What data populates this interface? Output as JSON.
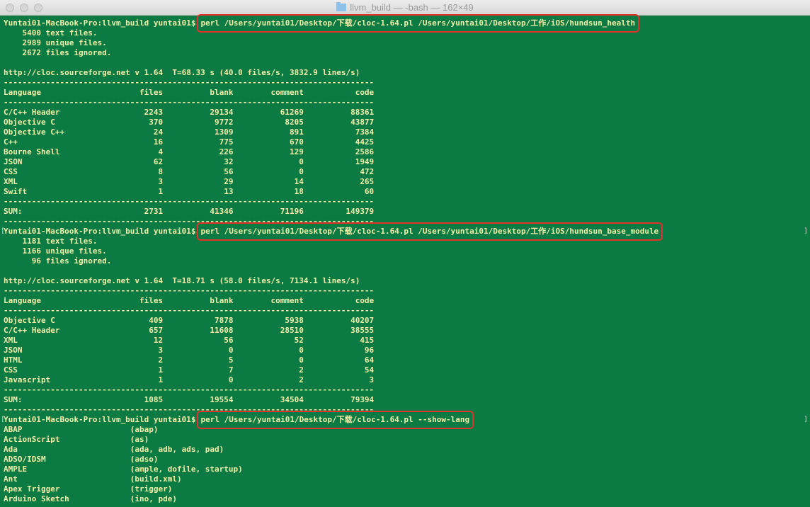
{
  "window": {
    "title": "llvm_build — -bash — 162×49"
  },
  "terminal": {
    "lines": [
      {
        "prompt": "Yuntai01-MacBook-Pro:llvm_build yuntai01$",
        "cmd": "perl /Users/yuntai01/Desktop/下载/cloc-1.64.pl /Users/yuntai01/Desktop/工作/iOS/hundsun_health"
      },
      {
        "text": "    5400 text files."
      },
      {
        "text": "    2989 unique files."
      },
      {
        "text": "    2672 files ignored."
      },
      {
        "text": ""
      },
      {
        "text": "http://cloc.sourceforge.net v 1.64  T=68.33 s (40.0 files/s, 3832.9 lines/s)"
      },
      {
        "text": "-------------------------------------------------------------------------------"
      },
      {
        "text": "Language                     files          blank        comment           code"
      },
      {
        "text": "-------------------------------------------------------------------------------"
      },
      {
        "text": "C/C++ Header                  2243          29134          61269          88361"
      },
      {
        "text": "Objective C                    370           9772           8205          43877"
      },
      {
        "text": "Objective C++                   24           1309            891           7384"
      },
      {
        "text": "C++                             16            775            670           4425"
      },
      {
        "text": "Bourne Shell                     4            226            129           2586"
      },
      {
        "text": "JSON                            62             32              0           1949"
      },
      {
        "text": "CSS                              8             56              0            472"
      },
      {
        "text": "XML                              3             29             14            265"
      },
      {
        "text": "Swift                            1             13             18             60"
      },
      {
        "text": "-------------------------------------------------------------------------------"
      },
      {
        "text": "SUM:                          2731          41346          71196         149379"
      },
      {
        "text": "-------------------------------------------------------------------------------"
      },
      {
        "prompt": "Yuntai01-MacBook-Pro:llvm_build yuntai01$",
        "cmd": "perl /Users/yuntai01/Desktop/下载/cloc-1.64.pl /Users/yuntai01/Desktop/工作/iOS/hundsun_base_module",
        "marks": true
      },
      {
        "text": "    1181 text files."
      },
      {
        "text": "    1166 unique files."
      },
      {
        "text": "      96 files ignored."
      },
      {
        "text": ""
      },
      {
        "text": "http://cloc.sourceforge.net v 1.64  T=18.71 s (58.0 files/s, 7134.1 lines/s)"
      },
      {
        "text": "-------------------------------------------------------------------------------"
      },
      {
        "text": "Language                     files          blank        comment           code"
      },
      {
        "text": "-------------------------------------------------------------------------------"
      },
      {
        "text": "Objective C                    409           7878           5938          40207"
      },
      {
        "text": "C/C++ Header                   657          11608          28510          38555"
      },
      {
        "text": "XML                             12             56             52            415"
      },
      {
        "text": "JSON                             3              0              0             96"
      },
      {
        "text": "HTML                             2              5              0             64"
      },
      {
        "text": "CSS                              1              7              2             54"
      },
      {
        "text": "Javascript                       1              0              2              3"
      },
      {
        "text": "-------------------------------------------------------------------------------"
      },
      {
        "text": "SUM:                          1085          19554          34504          79394"
      },
      {
        "text": "-------------------------------------------------------------------------------"
      },
      {
        "prompt": "Yuntai01-MacBook-Pro:llvm_build yuntai01$",
        "cmd": "perl /Users/yuntai01/Desktop/下载/cloc-1.64.pl --show-lang",
        "marks": true
      },
      {
        "text": "ABAP                       (abap)"
      },
      {
        "text": "ActionScript               (as)"
      },
      {
        "text": "Ada                        (ada, adb, ads, pad)"
      },
      {
        "text": "ADSO/IDSM                  (adso)"
      },
      {
        "text": "AMPLE                      (ample, dofile, startup)"
      },
      {
        "text": "Ant                        (build.xml)"
      },
      {
        "text": "Apex Trigger               (trigger)"
      },
      {
        "text": "Arduino Sketch             (ino, pde)"
      }
    ]
  },
  "colors": {
    "background": "#0b7a43",
    "text": "#f2f0a8",
    "highlight_box": "#e0312b"
  },
  "icons": {
    "title": "folder-icon"
  }
}
